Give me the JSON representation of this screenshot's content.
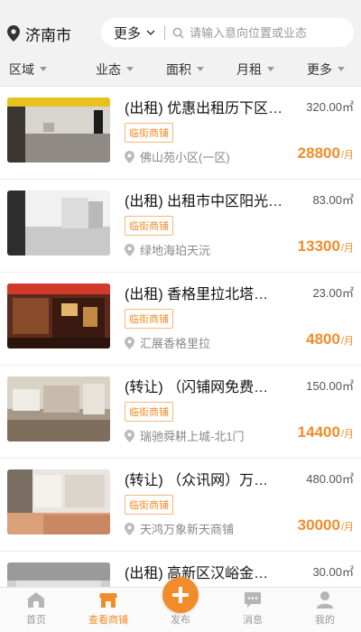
{
  "header": {
    "city": "济南市",
    "more_label": "更多",
    "search_placeholder": "请输入意向位置或业态"
  },
  "filters": [
    {
      "label": "区域"
    },
    {
      "label": "业态"
    },
    {
      "label": "面积"
    },
    {
      "label": "月租"
    },
    {
      "label": "更多"
    }
  ],
  "listings": [
    {
      "title": "(出租) 优惠出租历下区…",
      "area": "320.00㎡",
      "tag": "临街商铺",
      "location": "佛山苑小区(一区)",
      "price": "28800",
      "price_unit": "/月"
    },
    {
      "title": "(出租) 出租市中区阳光…",
      "area": "83.00㎡",
      "tag": "临街商铺",
      "location": "绿地海珀天沅",
      "price": "13300",
      "price_unit": "/月"
    },
    {
      "title": "(出租) 香格里拉北塔…",
      "area": "23.00㎡",
      "tag": "临街商铺",
      "location": "汇展香格里拉",
      "price": "4800",
      "price_unit": "/月"
    },
    {
      "title": "(转让) （闪铺网免费…",
      "area": "150.00㎡",
      "tag": "临街商铺",
      "location": "瑞驰舜耕上城-北1门",
      "price": "14400",
      "price_unit": "/月"
    },
    {
      "title": "(转让) （众讯网）万…",
      "area": "480.00㎡",
      "tag": "临街商铺",
      "location": "天鸿万象新天商铺",
      "price": "30000",
      "price_unit": "/月"
    },
    {
      "title": "(出租) 高新区汉峪金…",
      "area": "30.00㎡",
      "tag": "",
      "location": "",
      "price": "",
      "price_unit": ""
    }
  ],
  "bottom_nav": [
    {
      "label": "首页",
      "icon": "home-icon"
    },
    {
      "label": "查看商铺",
      "icon": "shop-icon"
    },
    {
      "label": "发布",
      "icon": "plus-icon"
    },
    {
      "label": "消息",
      "icon": "message-icon"
    },
    {
      "label": "我的",
      "icon": "user-icon"
    }
  ],
  "colors": {
    "accent": "#f08c2a",
    "background": "#f2f2f2"
  }
}
